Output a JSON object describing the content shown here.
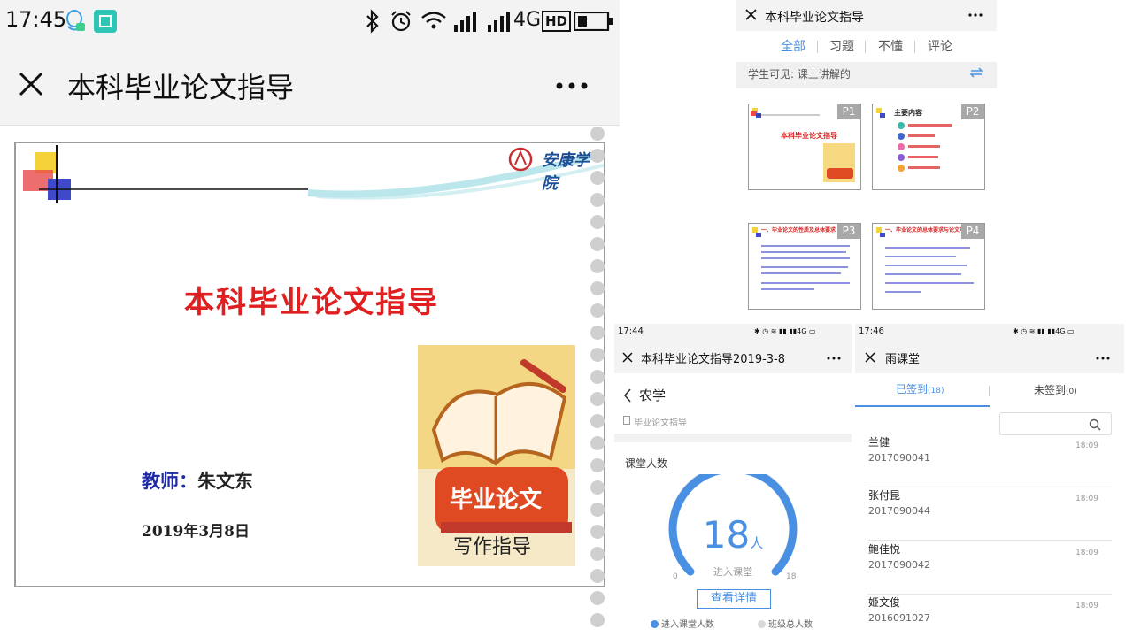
{
  "panel1": {
    "status": {
      "time": "17:45",
      "network": "4G",
      "hd": "HD"
    },
    "nav": {
      "title": "本科毕业论文指导"
    },
    "slide": {
      "title": "本科毕业论文指导",
      "teacher_label": "教师：",
      "teacher_name": "朱文东",
      "date": "2019年3月8日",
      "school": "安康学院",
      "book_line1": "毕业论文",
      "book_line2": "写作指导"
    }
  },
  "panel2": {
    "title": "本科毕业论文指导",
    "tabs": [
      "全部",
      "习题",
      "不懂",
      "评论"
    ],
    "active_tab": "全部",
    "visibility": "学生可见: 课上讲解的",
    "thumbs": [
      {
        "page": "P1",
        "heading": "本科毕业论文指导"
      },
      {
        "page": "P2",
        "heading": "主要内容"
      },
      {
        "page": "P3",
        "heading": "一、毕业论文的性质及总体要求"
      },
      {
        "page": "P4",
        "heading": "一、毕业论文的总体要求与论文写作规则"
      }
    ]
  },
  "panel3": {
    "status": {
      "time": "17:44"
    },
    "title": "本科毕业论文指导2019-3-8",
    "course": "农学",
    "subtitle": "毕业论文指导",
    "section": "课堂人数",
    "gauge": {
      "value": 18,
      "max": 18,
      "min_label": "0",
      "max_label": "18",
      "unit": "人",
      "label": "进入课堂"
    },
    "details_button": "查看详情",
    "legend": [
      {
        "label": "进入课堂人数",
        "color": "#4a90e2"
      },
      {
        "label": "班级总人数",
        "color": "#d9d9d9"
      }
    ]
  },
  "panel4": {
    "status": {
      "time": "17:46"
    },
    "title": "雨课堂",
    "tab_signed": "已签到",
    "tab_signed_count": "(18)",
    "tab_unsigned": "未签到",
    "tab_unsigned_count": "(0)",
    "students": [
      {
        "name": "兰健",
        "id": "2017090041",
        "time": "18:09"
      },
      {
        "name": "张付昆",
        "id": "2017090044",
        "time": "18:09"
      },
      {
        "name": "鲍佳悦",
        "id": "2017090042",
        "time": "18:09"
      },
      {
        "name": "姬文俊",
        "id": "2016091027",
        "time": "18:09"
      }
    ]
  },
  "colors": {
    "accent": "#4a90e2",
    "slide_title": "#e02020"
  }
}
